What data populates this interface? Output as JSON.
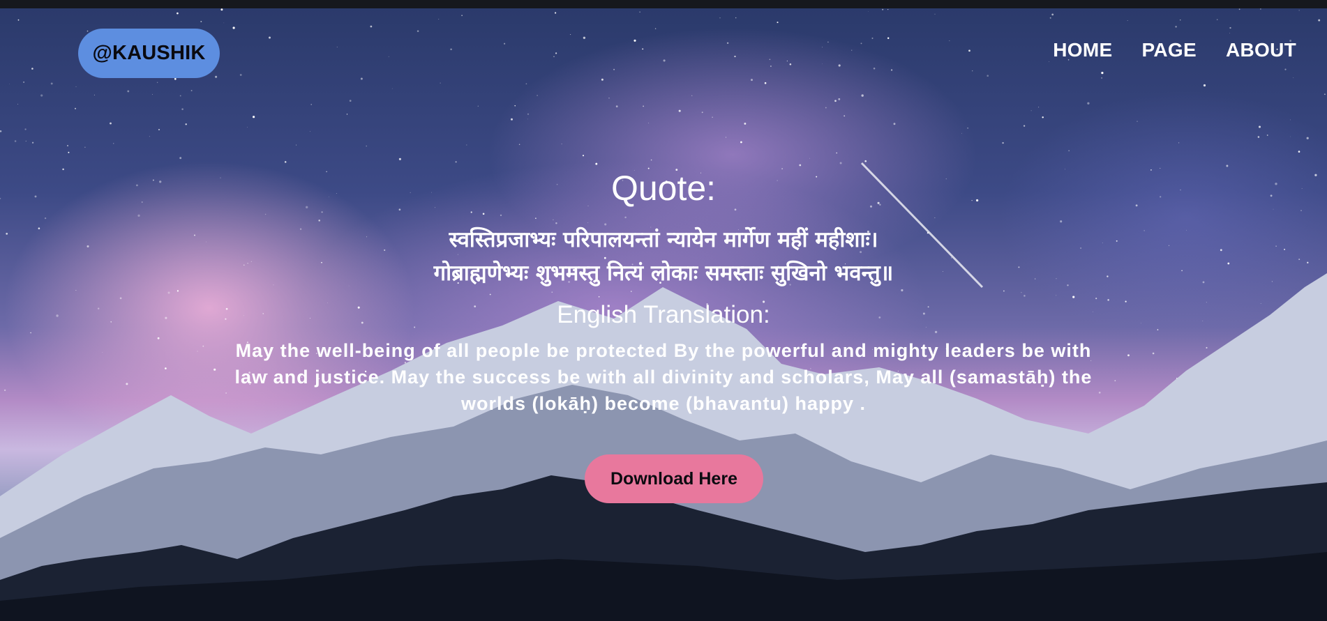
{
  "header": {
    "brand": "@KAUSHIK",
    "nav": [
      {
        "label": "HOME"
      },
      {
        "label": "PAGE"
      },
      {
        "label": "ABOUT"
      }
    ]
  },
  "main": {
    "quote_heading": "Quote:",
    "sanskrit_lines": [
      "स्वस्तिप्रजाभ्यः परिपालयन्तां न्यायेन मार्गेण महीं महीशाः।",
      "गोब्राह्मणेभ्यः शुभमस्तु नित्यं लोकाः समस्ताः सुखिनो भवन्तु॥"
    ],
    "translation_heading": "English Translation:",
    "translation_text": "May the well-being of all people be protected By the powerful and mighty leaders be with law and justice. May the success be with all divinity and scholars, May all (samastāḥ) the worlds (lokāḥ) become (bhavantu) happy .",
    "download_label": "Download Here"
  },
  "colors": {
    "brand_pill": "#5d8ee0",
    "download_button": "#e8789d",
    "text": "#ffffff"
  }
}
